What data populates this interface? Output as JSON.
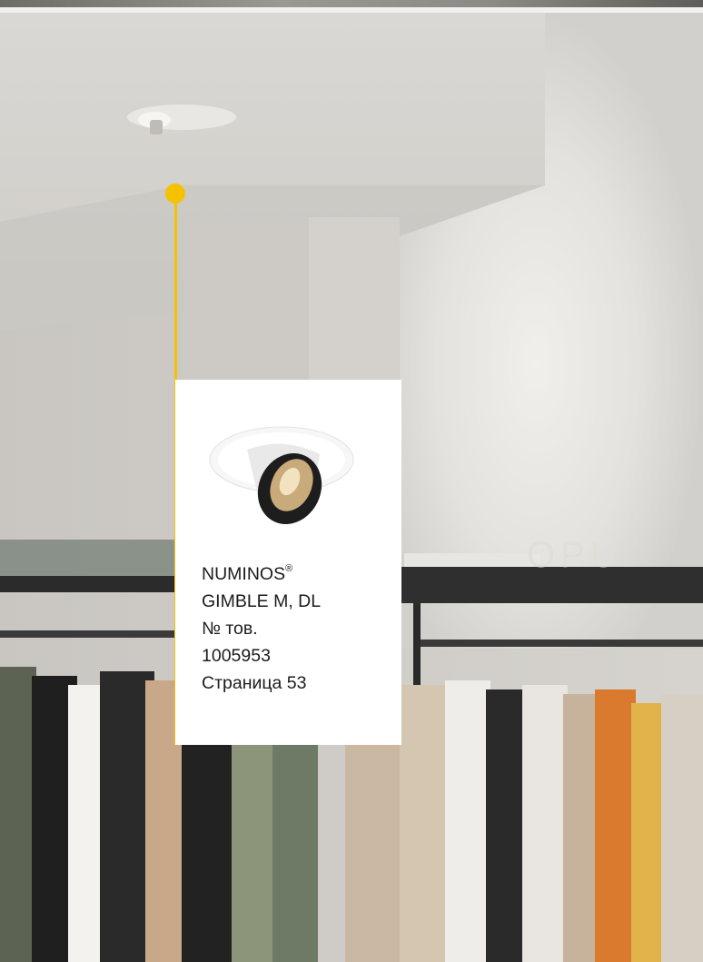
{
  "colors": {
    "accent_pin": "#f5c200",
    "card_background": "#ffffff",
    "text": "#1c1c1c"
  },
  "scene": {
    "store_sign": "OPU",
    "icon": "recessed-spotlight-photo"
  },
  "product": {
    "name": "NUMINOS",
    "registered_mark": "®",
    "variant": "GIMBLE M, DL",
    "article_label": "№ тов.",
    "article_number": "1005953",
    "page_reference": "Страница 53",
    "image_icon": "gimble-downlight-product-icon"
  }
}
